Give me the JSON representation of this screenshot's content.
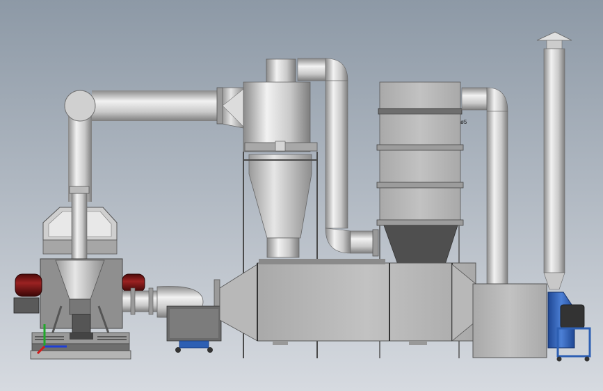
{
  "scene": {
    "annotation": "ø5",
    "colors": {
      "bg_top": "#8d99a6",
      "bg_bottom": "#d6dae0",
      "metal_dark": "#8f8f8f",
      "metal_mid": "#c4c4c4",
      "metal_light": "#eeeeee",
      "motor_red": "#7a1414",
      "fan_blue": "#2d5fb3",
      "axis_x": "#1f3fd6",
      "axis_y": "#1fa82a",
      "axis_z": "#d11b1b"
    },
    "components": [
      "vibrating-sieve-machine",
      "dust-hood",
      "cyclone-separator",
      "bag-filter",
      "activated-carbon-adsorption-box",
      "uv-photolysis-box",
      "centrifugal-fan",
      "exhaust-stack",
      "axis-triad-icon"
    ]
  }
}
